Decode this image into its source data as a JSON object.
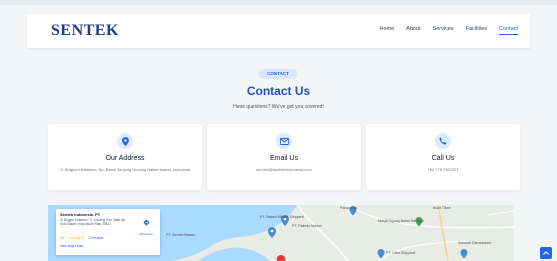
{
  "header": {
    "logo": "SENTEK",
    "nav": [
      "Home",
      "About",
      "Services",
      "Facilities",
      "Contact"
    ],
    "active": "Contact"
  },
  "hero": {
    "badge": "CONTACT",
    "title": "Contact Us",
    "subtitle": "Have questions? We've got you covered!"
  },
  "cards": [
    {
      "icon": "location-pin-icon",
      "title": "Our Address",
      "text": "Jl. Brigjend Katamso, Kp. Baruk Tanjung Uncang Batam Island, Indonesia"
    },
    {
      "icon": "envelope-icon",
      "title": "Email Us",
      "text": "service@sentek-indonesia.com"
    },
    {
      "icon": "phone-icon",
      "title": "Call Us",
      "text": "+62 778 7367001"
    }
  ],
  "map": {
    "place_name": "Sentek Indonesia. PT",
    "address": "Jl. Brigjen Katamso, Tj. Uncang, Kec. Batu Aji, Kota Batam, Kepulauan Riau 29422",
    "rating": "4.6",
    "stars": "★★★★★",
    "reviews": "13 reviews",
    "view_larger": "View larger map",
    "directions": "Directions",
    "labels": {
      "l1": "PT. Batam Marine Shipyard",
      "l2": "PT. Palindo Marine",
      "l3": "PT. Sentek Batam",
      "l4": "Panorama",
      "l5": "Masjid Agung Baitul Rahman",
      "l6": "PT. Citra Shipyard",
      "l7": "Sekolah Darussalam",
      "l8": "Bukit Tiban"
    }
  },
  "colors": {
    "brand": "#1e3a8a",
    "accent": "#2563eb",
    "page_bg": "#f4f5f7"
  }
}
